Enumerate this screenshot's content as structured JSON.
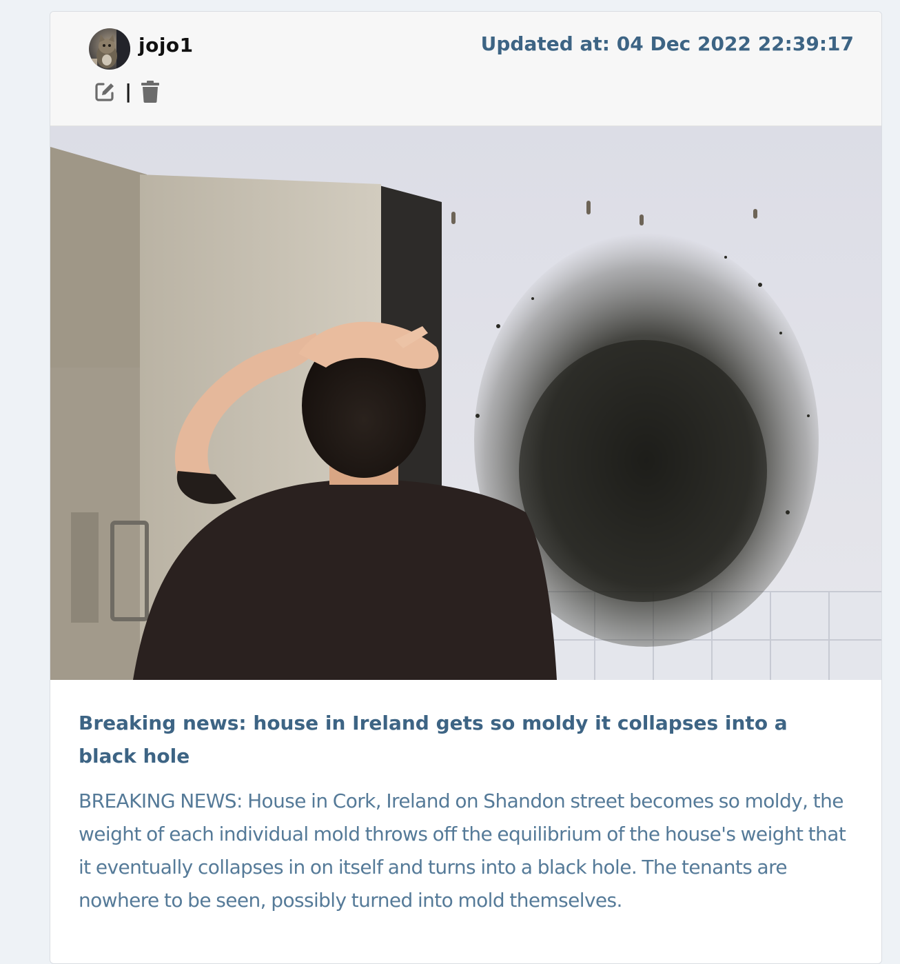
{
  "post": {
    "author": {
      "username": "jojo1",
      "avatar_icon": "cat-avatar"
    },
    "updated_at": "Updated at: 04 Dec 2022 22:39:17",
    "actions": {
      "edit_icon": "edit-icon",
      "separator": "|",
      "delete_icon": "trash-icon"
    },
    "image_subject": "post-photo",
    "title": "Breaking news: house in Ireland gets so moldy it collapses into a black hole",
    "body": "BREAKING NEWS: House in Cork, Ireland on Shandon street becomes so moldy, the weight of each individual mold throws off the equilibrium of the house's weight that it eventually collapses in on itself and turns into a black hole. The tenants are nowhere to be seen, possibly turned into mold themselves."
  },
  "colors": {
    "page_background": "#eef2f6",
    "header_background": "#f7f7f7",
    "accent_text": "#3d6484",
    "body_text": "#557a98",
    "icon_gray": "#6b6b6b"
  }
}
